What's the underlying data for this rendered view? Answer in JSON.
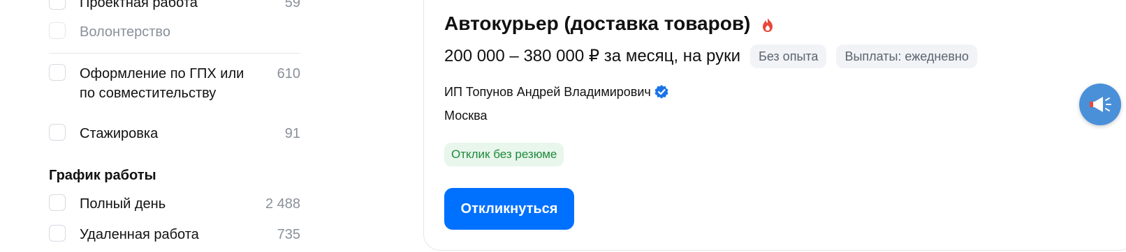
{
  "sidebar": {
    "filters_top": [
      {
        "label": "Проектная работа",
        "count": "59",
        "muted": false
      },
      {
        "label": "Волонтерство",
        "count": "",
        "muted": true
      }
    ],
    "filters_type": [
      {
        "label": "Оформление по ГПХ или по совместительству",
        "count": "610"
      },
      {
        "label": "Стажировка",
        "count": "91"
      }
    ],
    "schedule_title": "График работы",
    "filters_schedule": [
      {
        "label": "Полный день",
        "count": "2 488"
      },
      {
        "label": "Удаленная работа",
        "count": "735"
      }
    ]
  },
  "vacancy": {
    "title": "Автокурьер (доставка товаров)",
    "salary": "200 000 – 380 000 ₽ за месяц, на руки",
    "tags": [
      "Без опыта",
      "Выплаты: ежедневно"
    ],
    "company": "ИП Топунов Андрей Владимирович",
    "city": "Москва",
    "resume_badge": "Отклик без резюме",
    "apply_label": "Откликнуться"
  },
  "colors": {
    "accent": "#0070ff",
    "badge_green": "#1f8a3a",
    "fire": "#e8483a",
    "verified": "#1a73e8",
    "fab": "#4a90d9"
  },
  "icons": {
    "title_badge": "fire-icon",
    "company_badge": "verified-check-icon",
    "fab": "megaphone-icon"
  }
}
